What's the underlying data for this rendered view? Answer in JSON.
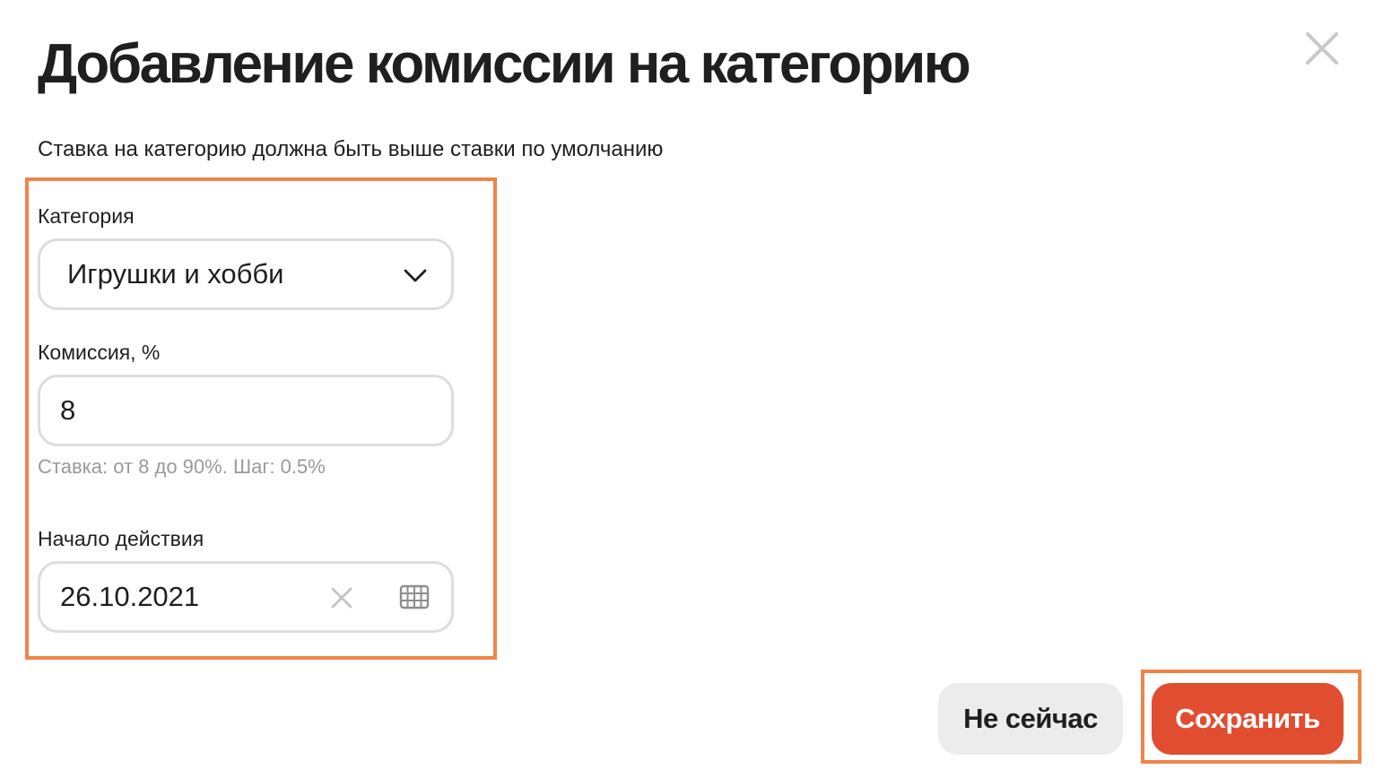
{
  "dialog": {
    "title": "Добавление комиссии на категорию",
    "subtitle": "Ставка на категорию должна быть выше ставки по умолчанию",
    "close_icon": "close-icon"
  },
  "form": {
    "category": {
      "label": "Категория",
      "value": "Игрушки и хобби",
      "icon": "chevron-down-icon"
    },
    "commission": {
      "label": "Комиссия, %",
      "value": "8",
      "hint": "Ставка: от 8 до 90%. Шаг: 0.5%"
    },
    "start_date": {
      "label": "Начало действия",
      "value": "26.10.2021",
      "clear_icon": "clear-icon",
      "calendar_icon": "calendar-icon"
    }
  },
  "actions": {
    "cancel_label": "Не сейчас",
    "save_label": "Сохранить"
  },
  "colors": {
    "accent": "#e14d2f",
    "highlight": "#ef8548",
    "border": "#dddddd",
    "hint": "#9a9a9a",
    "secondary_button": "#ececec"
  }
}
